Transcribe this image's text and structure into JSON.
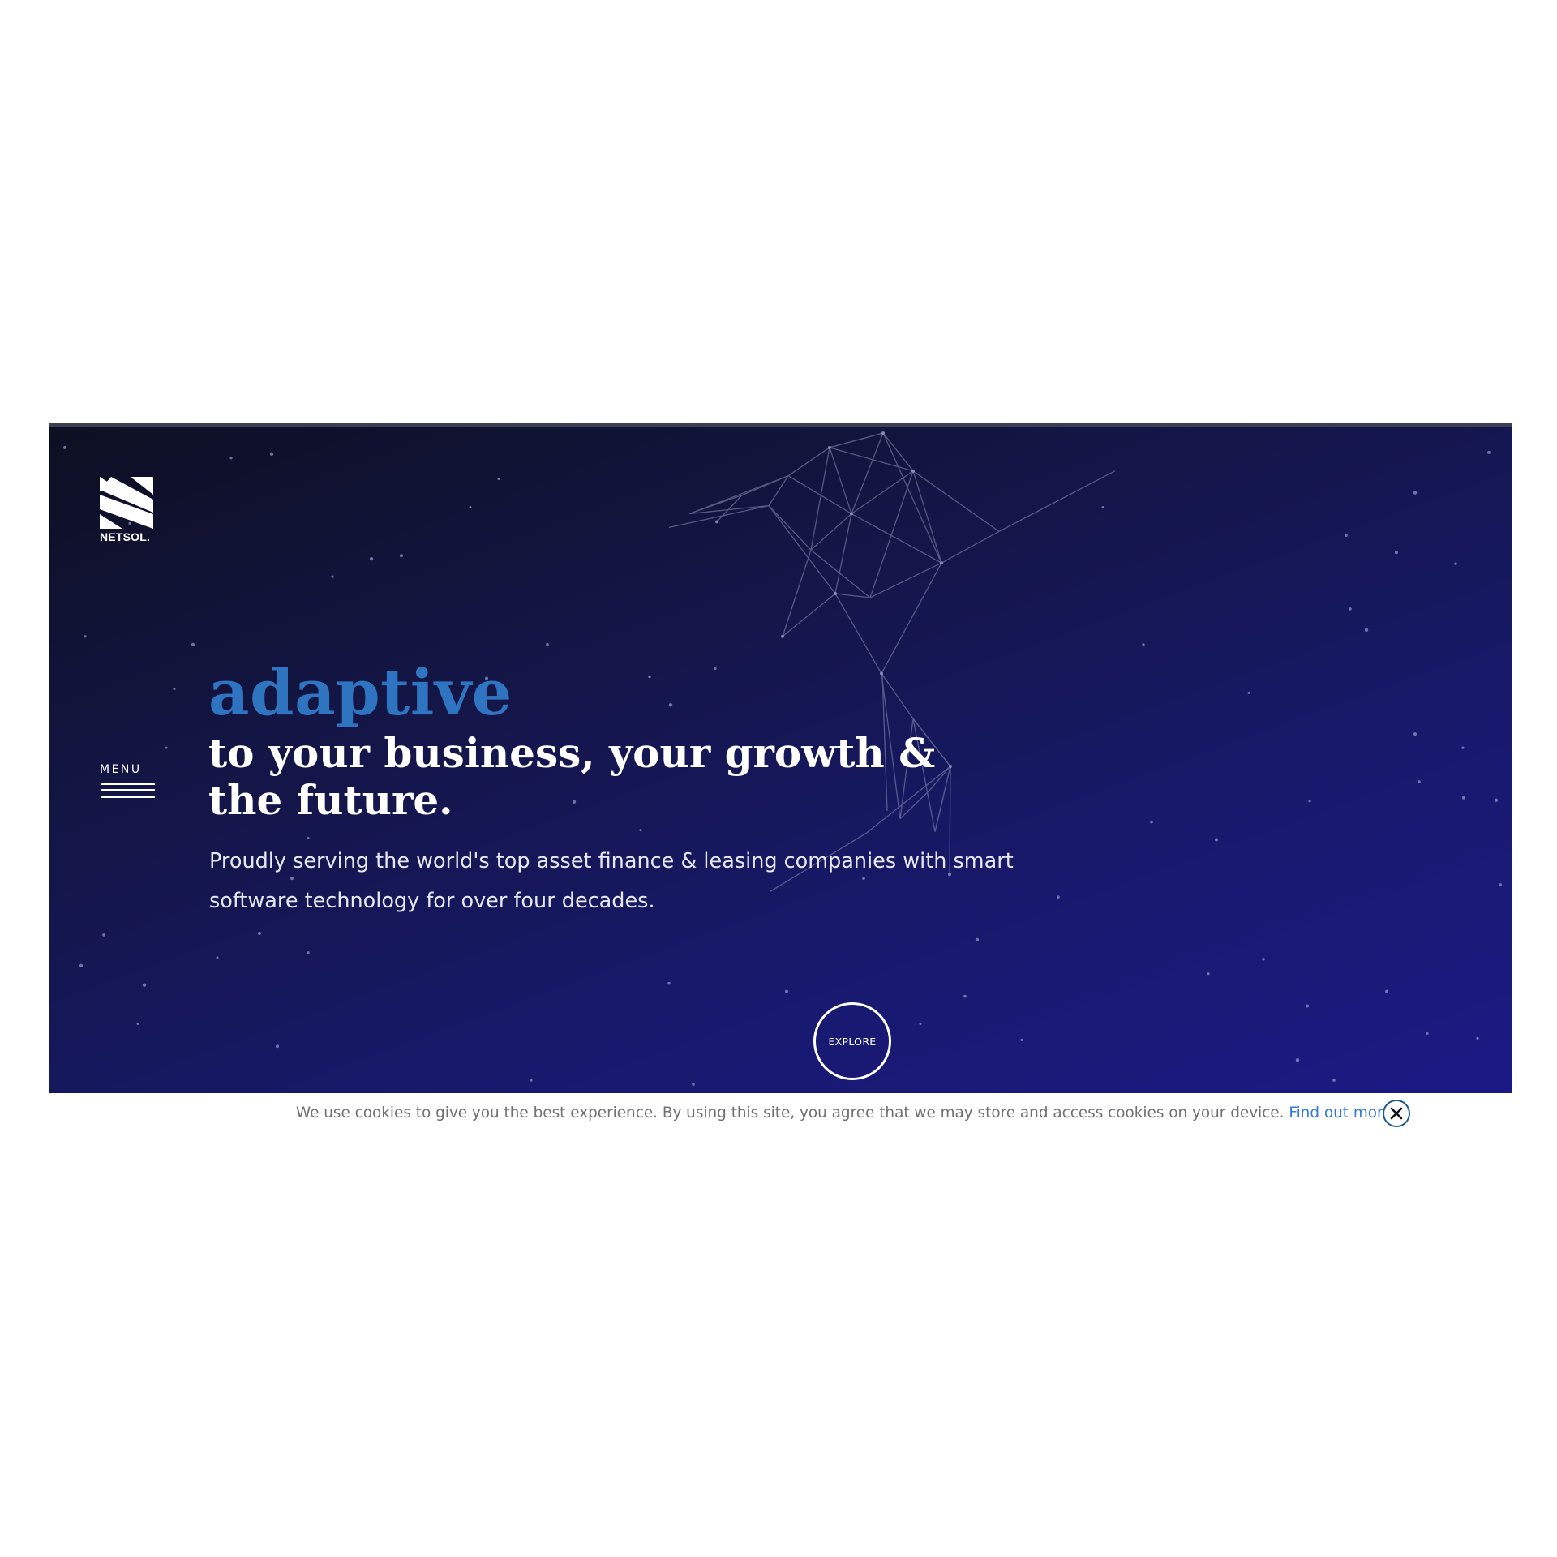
{
  "brand": {
    "logo_text": "NETSOL."
  },
  "menu": {
    "label": "MENU"
  },
  "hero": {
    "accent": "adaptive",
    "title": "to your business, your growth & the future.",
    "subtitle": "Proudly serving the world's top asset finance & leasing companies with smart software technology for over four decades.",
    "explore_label": "EXPLORE"
  },
  "cookie_bar": {
    "message": "We use cookies to give you the best experience. By using this site, you agree that we may store and access cookies on your device.",
    "link_label": "Find out more"
  },
  "colors": {
    "accent_blue": "#2f74c0",
    "hero_dark": "#0d0f22",
    "hero_blue": "#1b1a85",
    "link_blue": "#2f7ad6",
    "close_ring": "#1e5b8c",
    "cookie_text": "#707070"
  },
  "icons": {
    "logo": "netsol-s-logo-icon",
    "menu": "hamburger-icon",
    "close": "close-circle-icon",
    "decoration": "wireframe-bird-icon"
  }
}
